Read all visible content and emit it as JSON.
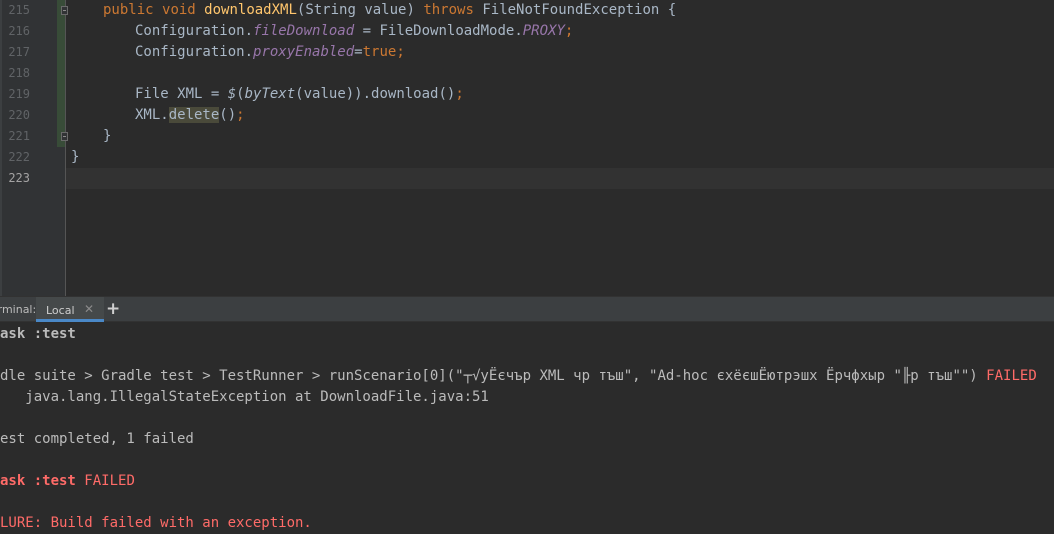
{
  "editor": {
    "line_numbers": [
      "215",
      "216",
      "217",
      "218",
      "219",
      "220",
      "221",
      "222",
      "223"
    ],
    "lines": {
      "l215": {
        "kw1": "public",
        "kw2": "void",
        "fn": "downloadXML",
        "a": "(String value) ",
        "kw3": "throws",
        "b": " FileNotFoundException {"
      },
      "l216": {
        "a": "Configuration.",
        "field": "fileDownload",
        "b": " = FileDownloadMode.",
        "static": "PROXY",
        "kw": ";"
      },
      "l217": {
        "a": "Configuration.",
        "field": "proxyEnabled",
        "b": "=",
        "kw": "true;"
      },
      "l219": {
        "a": "File XML = ",
        "fn": "$",
        "b": "(",
        "static": "byText",
        "c": "(value)).download()",
        "kw": ";"
      },
      "l220": {
        "a": "XML.",
        "hl": "delete",
        "b": "()",
        "kw": ";"
      },
      "l221": {
        "a": "}"
      },
      "l222": {
        "a": "}"
      }
    }
  },
  "terminal": {
    "title": "Terminal:",
    "tab_local": "Local",
    "tab_close": "✕",
    "add_tab": "+",
    "lines": {
      "t1": "ask :test",
      "t2a": "dle suite > Gradle test > TestRunner > runScenario[0](\"┬√уЁєчър XML чр тъш\", \"Ad-hoc єхёєшЁютрэшх Ёрчфхыр \"╟р тъш\"\") ",
      "t2b": "FAILED",
      "t3": "   java.lang.IllegalStateException at DownloadFile.java:51",
      "t4": "est completed, 1 failed",
      "t5a": "ask :test ",
      "t5b": "FAILED",
      "t6": "LURE: Build failed with an exception."
    }
  }
}
